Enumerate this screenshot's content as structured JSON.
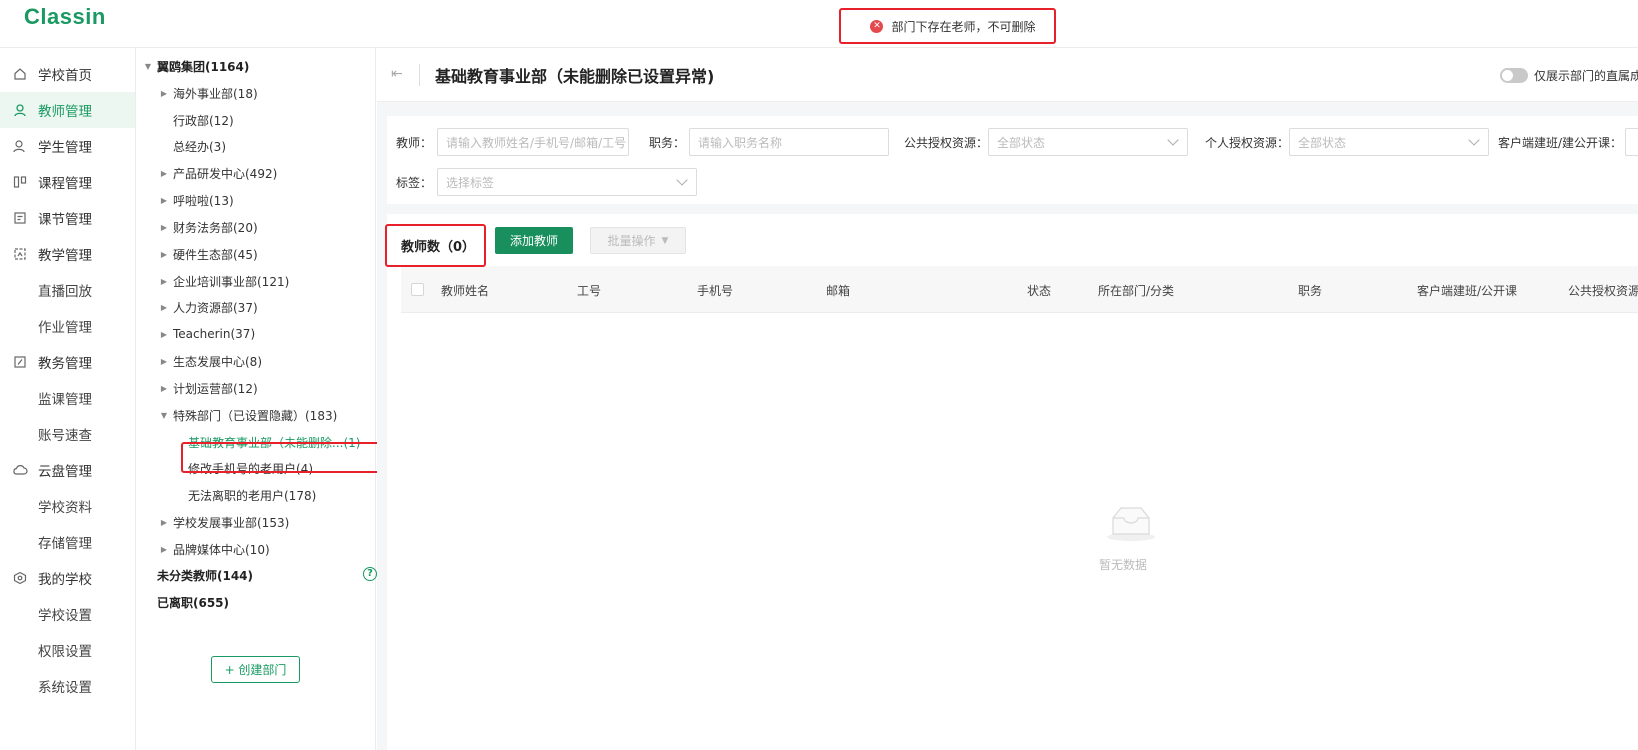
{
  "app": {
    "logo": "Classin"
  },
  "toast": {
    "message": "部门下存在老师，不可删除"
  },
  "nav": {
    "items": [
      {
        "label": "学校首页",
        "icon": "home-icon"
      },
      {
        "label": "教师管理",
        "icon": "user-icon",
        "active": true
      },
      {
        "label": "学生管理",
        "icon": "student-icon"
      },
      {
        "label": "课程管理",
        "icon": "course-icon"
      },
      {
        "label": "课节管理",
        "icon": "lesson-icon"
      },
      {
        "label": "教学管理",
        "icon": "teaching-icon"
      },
      {
        "label": "直播回放",
        "sub": true
      },
      {
        "label": "作业管理",
        "sub": true
      },
      {
        "label": "教务管理",
        "icon": "academic-icon"
      },
      {
        "label": "监课管理",
        "sub": true
      },
      {
        "label": "账号速查",
        "sub": true
      },
      {
        "label": "云盘管理",
        "icon": "cloud-icon"
      },
      {
        "label": "学校资料",
        "sub": true
      },
      {
        "label": "存储管理",
        "sub": true
      },
      {
        "label": "我的学校",
        "icon": "school-icon"
      },
      {
        "label": "学校设置",
        "sub": true
      },
      {
        "label": "权限设置",
        "sub": true
      },
      {
        "label": "系统设置",
        "sub": true
      }
    ]
  },
  "tree": {
    "root": "翼鸥集团(1164)",
    "items": [
      {
        "label": "海外事业部(18)"
      },
      {
        "label": "行政部(12)"
      },
      {
        "label": "总经办(3)"
      },
      {
        "label": "产品研发中心(492)"
      },
      {
        "label": "呼啦啦(13)"
      },
      {
        "label": "财务法务部(20)"
      },
      {
        "label": "硬件生态部(45)"
      },
      {
        "label": "企业培训事业部(121)"
      },
      {
        "label": "人力资源部(37)"
      },
      {
        "label": "Teacherin(37)"
      },
      {
        "label": "生态发展中心(8)"
      },
      {
        "label": "计划运营部(12)"
      },
      {
        "label": "特殊部门（已设置隐藏）(183)"
      },
      {
        "label": "基础教育事业部（未能删除...(1)"
      },
      {
        "label": "修改手机号的老用户(4)"
      },
      {
        "label": "无法离职的老用户(178)"
      },
      {
        "label": "学校发展事业部(153)"
      },
      {
        "label": "品牌媒体中心(10)"
      }
    ],
    "unclassified": "未分类教师(144)",
    "resigned": "已离职(655)",
    "create_label": "+ 创建部门"
  },
  "header": {
    "title": "基础教育事业部（未能删除已设置异常)",
    "toggle_label": "仅展示部门的直属成员"
  },
  "filters": {
    "teacher_label": "教师：",
    "teacher_placeholder": "请输入教师姓名/手机号/邮箱/工号",
    "position_label": "职务：",
    "position_placeholder": "请输入职务名称",
    "public_label": "公共授权资源：",
    "public_value": "全部状态",
    "personal_label": "个人授权资源：",
    "personal_value": "全部状态",
    "client_label": "客户端建班/建公开课：",
    "tag_label": "标签：",
    "tag_placeholder": "选择标签"
  },
  "list": {
    "count_label": "教师数（0）",
    "add_label": "添加教师",
    "batch_label": "批量操作",
    "columns": [
      "教师姓名",
      "工号",
      "手机号",
      "邮箱",
      "状态",
      "所在部门/分类",
      "职务",
      "客户端建班/公开课",
      "公共授权资源"
    ],
    "empty_text": "暂无数据"
  }
}
